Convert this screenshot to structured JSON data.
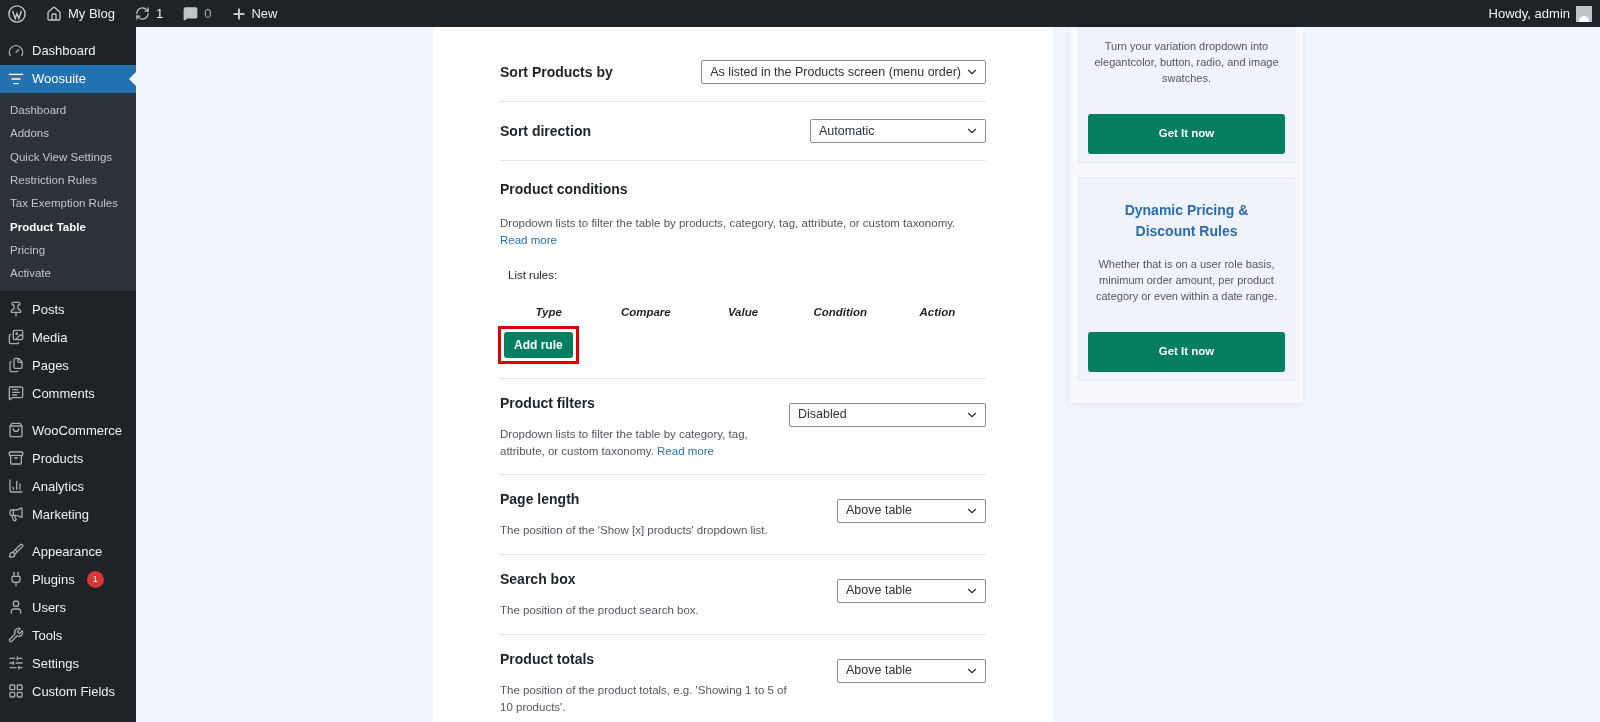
{
  "admin_bar": {
    "site": "My Blog",
    "updates": "1",
    "comments": "0",
    "new": "New",
    "greeting": "Howdy, admin"
  },
  "sidebar": {
    "groups": [
      [
        {
          "label": "Dashboard",
          "selected": false
        },
        {
          "label": "Woosuite",
          "selected": true,
          "children": [
            {
              "label": "Dashboard",
              "selected": false
            },
            {
              "label": "Addons",
              "selected": false
            },
            {
              "label": "Quick View Settings",
              "selected": false
            },
            {
              "label": "Restriction Rules",
              "selected": false
            },
            {
              "label": "Tax Exemption Rules",
              "selected": false
            },
            {
              "label": "Product Table",
              "selected": true
            },
            {
              "label": "Pricing",
              "selected": false
            },
            {
              "label": "Activate",
              "selected": false
            }
          ]
        }
      ],
      [
        {
          "label": "Posts",
          "selected": false
        },
        {
          "label": "Media",
          "selected": false
        },
        {
          "label": "Pages",
          "selected": false
        },
        {
          "label": "Comments",
          "selected": false
        }
      ],
      [
        {
          "label": "WooCommerce",
          "selected": false
        },
        {
          "label": "Products",
          "selected": false
        },
        {
          "label": "Analytics",
          "selected": false
        },
        {
          "label": "Marketing",
          "selected": false
        }
      ],
      [
        {
          "label": "Appearance",
          "selected": false
        },
        {
          "label": "Plugins",
          "selected": false,
          "badge": "1"
        },
        {
          "label": "Users",
          "selected": false
        },
        {
          "label": "Tools",
          "selected": false
        },
        {
          "label": "Settings",
          "selected": false
        },
        {
          "label": "Custom Fields",
          "selected": false
        }
      ]
    ]
  },
  "settings": [
    {
      "kind": "select",
      "label": "Sort Products by",
      "value": "As listed in the Products screen (menu order)"
    },
    {
      "kind": "select",
      "label": "Sort direction",
      "value": "Automatic"
    },
    {
      "kind": "rules",
      "label": "Product conditions",
      "description": "Dropdown lists to filter the table by products, category, tag, attribute, or custom taxonomy.",
      "link": "Read more",
      "list_label": "List rules:",
      "columns": [
        "Type",
        "Compare",
        "Value",
        "Condition",
        "Action"
      ],
      "button": {
        "label": "Add rule",
        "highlighted": true
      }
    },
    {
      "kind": "select",
      "label": "Product filters",
      "description": "Dropdown lists to filter the table by category, tag, attribute, or custom taxonomy.",
      "link": "Read more",
      "value": "Disabled"
    },
    {
      "kind": "select",
      "label": "Page length",
      "description": "The position of the 'Show [x] products' dropdown list.",
      "value": "Above table"
    },
    {
      "kind": "select",
      "label": "Search box",
      "description": "The position of the product search box.",
      "value": "Above table"
    },
    {
      "kind": "select",
      "label": "Product totals",
      "description": "The position of the product totals, e.g. 'Showing 1 to 5 of 10 products'.",
      "value": "Above table"
    }
  ],
  "promos": [
    {
      "text": "Turn your variation dropdown into elegantcolor, button, radio, and image swatches.",
      "button": "Get It now"
    },
    {
      "title": "Dynamic Pricing & Discount Rules",
      "text": "Whether that is on a user role basis, minimum order amount, per product category or even within a date range.",
      "button": "Get It now"
    }
  ]
}
